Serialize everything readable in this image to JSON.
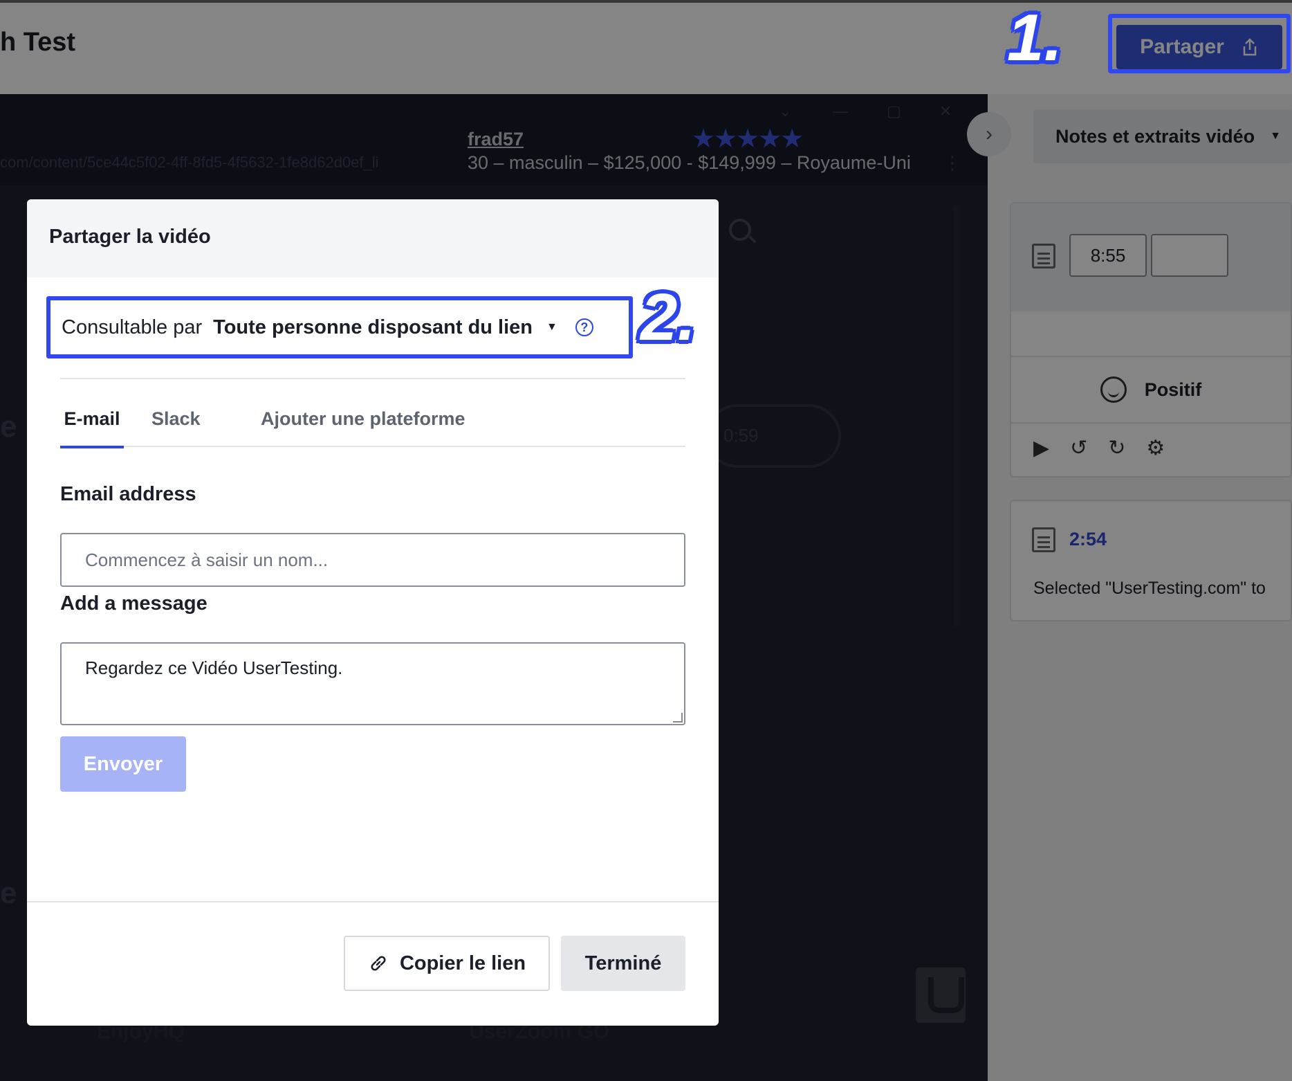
{
  "header": {
    "page_title": "h Test",
    "share_label": "Partager"
  },
  "video": {
    "url_fragment": "com/content/5ce44c5f02-4ff-8fd5-4f5632-1fe8d62d0ef_li",
    "username": "frad57",
    "stars": "★★★★★",
    "demographics": "30 – masculin – $125,000 - $149,999 – Royaume-Uni",
    "bg_time": "0:59",
    "footer_left": "EnjoyHQ",
    "footer_right": "UserZoom GO"
  },
  "sidebar": {
    "dropdown_label": "Notes et extraits vidéo",
    "clip_start": "8:55",
    "clip_end": "",
    "sentiment": "Positif",
    "note_time": "2:54",
    "note_text": "Selected \"UserTesting.com\" to"
  },
  "annotations": {
    "step1": "1.",
    "step2": "2."
  },
  "modal": {
    "title": "Partager la vidéo",
    "viewable_label": "Consultable par",
    "viewable_value": "Toute personne disposant du lien",
    "tabs": [
      {
        "label": "E-mail"
      },
      {
        "label": "Slack"
      },
      {
        "label": "Ajouter une plateforme"
      }
    ],
    "email_label": "Email address",
    "email_placeholder": "Commencez à saisir un nom...",
    "message_label": "Add a message",
    "message_value": "Regardez ce Vidéo UserTesting.",
    "send_label": "Envoyer",
    "copy_label": "Copier le lien",
    "done_label": "Terminé"
  },
  "colors": {
    "accent": "#3049d4",
    "annotation": "#3148f0",
    "send_disabled": "#a6b3f7"
  }
}
